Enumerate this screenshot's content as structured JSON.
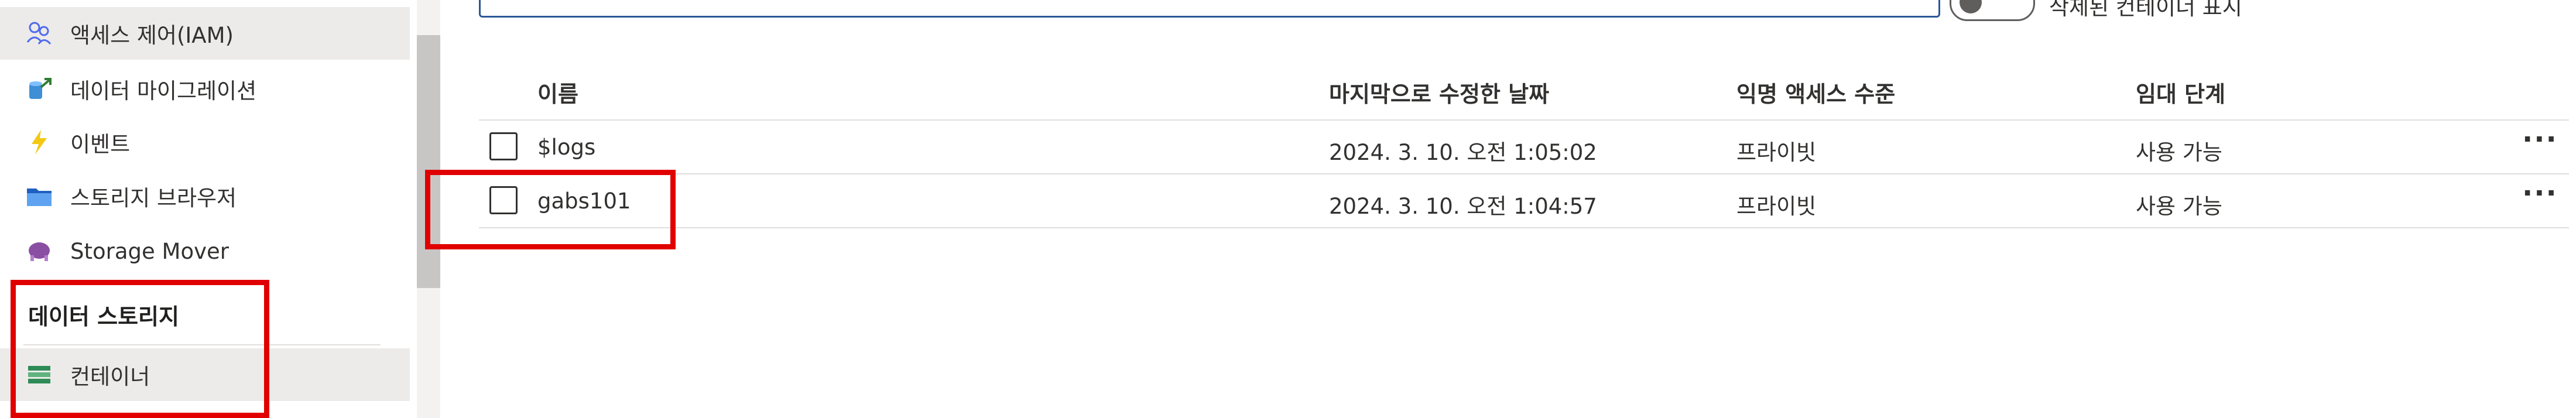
{
  "sidebar": {
    "items": [
      {
        "label": "액세스 제어(IAM)",
        "icon": "people-icon",
        "color": "#4f6bed"
      },
      {
        "label": "데이터 마이그레이션",
        "icon": "migration-icon",
        "color": "#2e7d32"
      },
      {
        "label": "이벤트",
        "icon": "lightning-icon",
        "color": "#f2c811"
      },
      {
        "label": "스토리지 브라우저",
        "icon": "folder-icon",
        "color": "#1f5fbf"
      },
      {
        "label": "Storage Mover",
        "icon": "storage-mover-icon",
        "color": "#8a4fa3"
      }
    ],
    "section_title": "데이터 스토리지",
    "selected_item": {
      "label": "컨테이너",
      "icon": "container-icon",
      "color": "#2e8b57"
    }
  },
  "toolbar": {
    "toggle_label": "삭제된 컨테이너 표시"
  },
  "table": {
    "columns": [
      "이름",
      "마지막으로 수정한 날짜",
      "익명 액세스 수준",
      "임대 단계"
    ],
    "rows": [
      {
        "name": "$logs",
        "modified": "2024. 3. 10. 오전 1:05:02",
        "access": "프라이빗",
        "lease": "사용 가능",
        "more": "···"
      },
      {
        "name": "gabs101",
        "modified": "2024. 3. 10. 오전 1:04:57",
        "access": "프라이빗",
        "lease": "사용 가능",
        "more": "···"
      }
    ]
  },
  "colors": {
    "highlight": "#e00000",
    "accent": "#2b5797",
    "selected_bg": "#edebe9"
  }
}
